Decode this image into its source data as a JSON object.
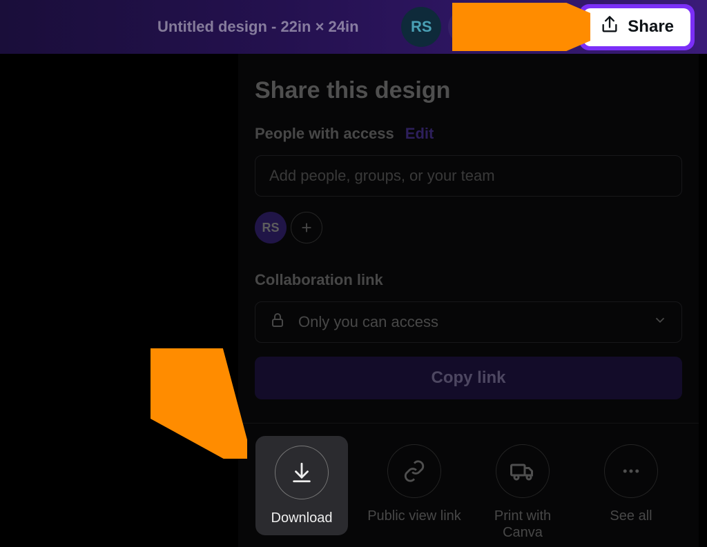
{
  "header": {
    "title": "Untitled design - 22in × 24in",
    "avatar": "RS",
    "share_label": "Share"
  },
  "panel": {
    "heading": "Share this design",
    "access_label": "People with access",
    "edit_label": "Edit",
    "people_placeholder": "Add people, groups, or your team",
    "member_initials": "RS",
    "collab_label": "Collaboration link",
    "access_value": "Only you can access",
    "copy_link": "Copy link",
    "options": {
      "download": "Download",
      "public": "Public view link",
      "print": "Print with Canva",
      "seeall": "See all"
    }
  }
}
